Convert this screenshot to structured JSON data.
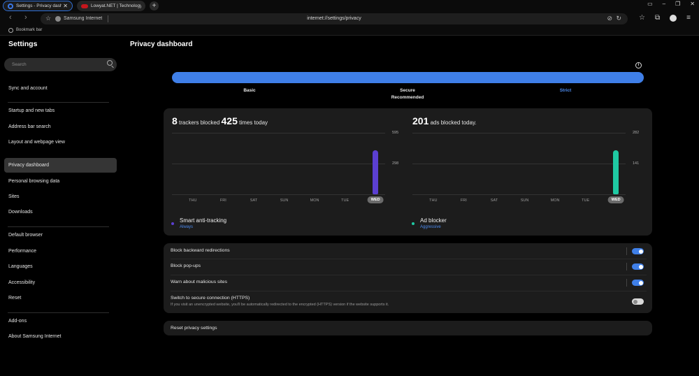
{
  "tabs": [
    {
      "title": "Settings - Privacy dashb",
      "active": true
    },
    {
      "title": "Lowyat.NET | Technology",
      "active": false
    }
  ],
  "address_bar": {
    "site_name": "Samsung Internet",
    "url": "internet://settings/privacy"
  },
  "bookmark_bar": {
    "label": "Bookmark bar"
  },
  "sidebar": {
    "title": "Settings",
    "search_placeholder": "Search",
    "items": [
      {
        "label": "Sync and account"
      },
      {
        "label": "Startup and new tabs"
      },
      {
        "label": "Address bar search"
      },
      {
        "label": "Layout and webpage view"
      },
      {
        "label": "Privacy dashboard",
        "active": true
      },
      {
        "label": "Personal browsing data"
      },
      {
        "label": "Sites"
      },
      {
        "label": "Downloads"
      },
      {
        "label": "Default browser"
      },
      {
        "label": "Performance"
      },
      {
        "label": "Languages"
      },
      {
        "label": "Accessibility"
      },
      {
        "label": "Reset"
      },
      {
        "label": "Add-ons"
      },
      {
        "label": "About Samsung Internet"
      }
    ]
  },
  "main": {
    "title": "Privacy dashboard",
    "levels": {
      "basic": "Basic",
      "secure": "Secure",
      "secure_sub": "Recommended",
      "strict": "Strict",
      "selected": "Strict"
    },
    "trackers": {
      "count": "8",
      "text1": "trackers blocked",
      "times": "425",
      "text2": "times today",
      "legend_title": "Smart anti-tracking",
      "legend_sub": "Always"
    },
    "ads": {
      "count": "201",
      "text1": "ads blocked today.",
      "legend_title": "Ad blocker",
      "legend_sub": "Aggressive"
    },
    "toggles": [
      {
        "label": "Block backward redirections",
        "on": true
      },
      {
        "label": "Block pop-ups",
        "on": true
      },
      {
        "label": "Warn about malicious sites",
        "on": true
      },
      {
        "label": "Switch to secure connection (HTTPS)",
        "description": "If you visit an unencrypted website, you'll be automatically redirected to the encrypted (HTTPS) version if the website supports it.",
        "on": false
      }
    ],
    "reset_label": "Reset privacy settings"
  },
  "chart_data": [
    {
      "type": "bar",
      "categories": [
        "THU",
        "FRI",
        "SAT",
        "SUN",
        "MON",
        "TUE",
        "WED"
      ],
      "values": [
        0,
        0,
        0,
        0,
        0,
        0,
        425
      ],
      "yticks": [
        "595",
        "298"
      ],
      "ylim": [
        0,
        595
      ],
      "today": "WED",
      "color": "#5b3fd1"
    },
    {
      "type": "bar",
      "categories": [
        "THU",
        "FRI",
        "SAT",
        "SUN",
        "MON",
        "TUE",
        "WED"
      ],
      "values": [
        0,
        0,
        0,
        0,
        0,
        0,
        201
      ],
      "yticks": [
        "282",
        "141"
      ],
      "ylim": [
        0,
        282
      ],
      "today": "WED",
      "color": "#1fc9a3"
    }
  ],
  "colors": {
    "accent": "#3f7fe8",
    "trackers": "#5b3fd1",
    "ads": "#1fc9a3"
  }
}
